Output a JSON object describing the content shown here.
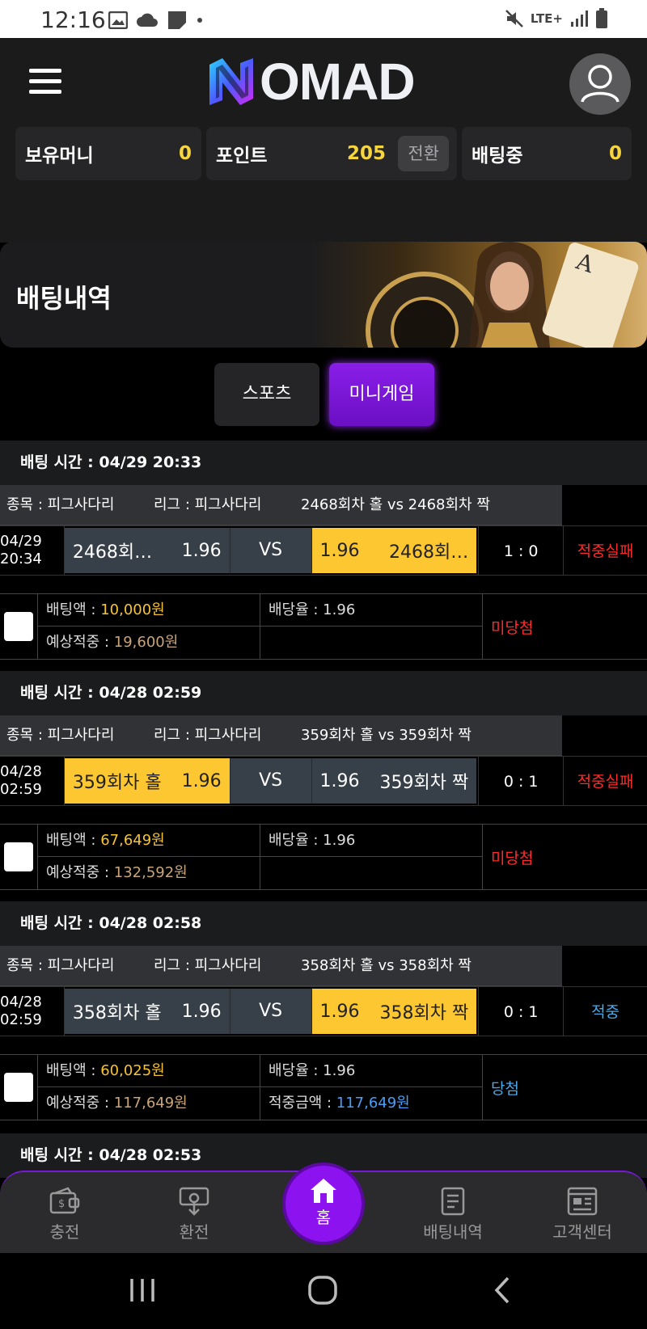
{
  "status_bar": {
    "time": "12:16",
    "network": "LTE+"
  },
  "header": {
    "logo_text": "OMAD",
    "money": [
      {
        "label": "보유머니",
        "value": "0"
      },
      {
        "label": "포인트",
        "value": "205",
        "button": "전환"
      },
      {
        "label": "배팅중",
        "value": "0"
      }
    ]
  },
  "banner": {
    "title": "배팅내역"
  },
  "tabs": [
    "스포츠",
    "미니게임"
  ],
  "bets": [
    {
      "time_label": "배팅 시간 : 04/29 20:33",
      "sport": "종목 : 피그사다리",
      "league": "리그 : 피그사다리",
      "match": "2468회차 홀  vs  2468회차 짝",
      "date": "04/29",
      "clock": "20:34",
      "home": "2468회…",
      "home_odds": "1.96",
      "vs": "VS",
      "away_odds": "1.96",
      "away": "2468회…",
      "score": "1 : 0",
      "result": "적중실패",
      "bet_label": "배팅액 : ",
      "bet_amount": "10,000원",
      "odds_label": "배당율 : 1.96",
      "expected_label": "예상적중 : ",
      "expected": "19,600원",
      "win_label": "",
      "win_amount": "",
      "status": "미당첨"
    },
    {
      "time_label": "배팅 시간 : 04/28 02:59",
      "sport": "종목 : 피그사다리",
      "league": "리그 : 피그사다리",
      "match": "359회차 홀  vs  359회차 짝",
      "date": "04/28",
      "clock": "02:59",
      "home": "359회차 홀",
      "home_odds": "1.96",
      "vs": "VS",
      "away_odds": "1.96",
      "away": "359회차 짝",
      "score": "0 : 1",
      "result": "적중실패",
      "bet_label": "배팅액 : ",
      "bet_amount": "67,649원",
      "odds_label": "배당율 : 1.96",
      "expected_label": "예상적중 : ",
      "expected": "132,592원",
      "win_label": "",
      "win_amount": "",
      "status": "미당첨"
    },
    {
      "time_label": "배팅 시간 : 04/28 02:58",
      "sport": "종목 : 피그사다리",
      "league": "리그 : 피그사다리",
      "match": "358회차 홀  vs  358회차 짝",
      "date": "04/28",
      "clock": "02:59",
      "home": "358회차 홀",
      "home_odds": "1.96",
      "vs": "VS",
      "away_odds": "1.96",
      "away": "358회차 짝",
      "score": "0 : 1",
      "result": "적중",
      "bet_label": "배팅액 : ",
      "bet_amount": "60,025원",
      "odds_label": "배당율 : 1.96",
      "expected_label": "예상적중 : ",
      "expected": "117,649원",
      "win_label": "적중금액 : ",
      "win_amount": "117,649원",
      "status": "당첨"
    }
  ],
  "next_bet_time": "배팅 시간 : 04/28 02:53",
  "bottom_nav": {
    "charge": "충전",
    "exchange": "환전",
    "home": "홈",
    "history": "배팅내역",
    "support": "고객센터"
  }
}
